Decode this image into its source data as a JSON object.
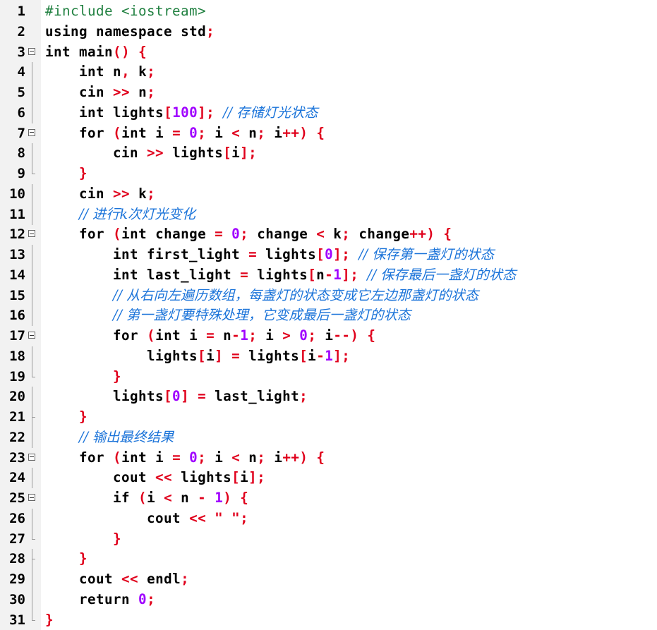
{
  "editor": {
    "language": "C++",
    "colors": {
      "background": "#ffffff",
      "gutter": "#f2f2f2",
      "operator": "#e0001c",
      "number": "#a000ff",
      "comment": "#1a73d9",
      "preprocessor": "#208040"
    },
    "lines": [
      {
        "n": "1",
        "text": "#include <iostream>"
      },
      {
        "n": "2",
        "text": "using namespace std;"
      },
      {
        "n": "3",
        "text": "int main() {"
      },
      {
        "n": "4",
        "text": "    int n, k;"
      },
      {
        "n": "5",
        "text": "    cin >> n;"
      },
      {
        "n": "6",
        "text": "    int lights[100]; // 存储灯光状态"
      },
      {
        "n": "7",
        "text": "    for (int i = 0; i < n; i++) {"
      },
      {
        "n": "8",
        "text": "        cin >> lights[i];"
      },
      {
        "n": "9",
        "text": "    }"
      },
      {
        "n": "10",
        "text": "    cin >> k;"
      },
      {
        "n": "11",
        "text": "    // 进行k次灯光变化"
      },
      {
        "n": "12",
        "text": "    for (int change = 0; change < k; change++) {"
      },
      {
        "n": "13",
        "text": "        int first_light = lights[0]; // 保存第一盏灯的状态"
      },
      {
        "n": "14",
        "text": "        int last_light = lights[n-1]; // 保存最后一盏灯的状态"
      },
      {
        "n": "15",
        "text": "        // 从右向左遍历数组，每盏灯的状态变成它左边那盏灯的状态"
      },
      {
        "n": "16",
        "text": "        // 第一盏灯要特殊处理，它变成最后一盏灯的状态"
      },
      {
        "n": "17",
        "text": "        for (int i = n-1; i > 0; i--) {"
      },
      {
        "n": "18",
        "text": "            lights[i] = lights[i-1];"
      },
      {
        "n": "19",
        "text": "        }"
      },
      {
        "n": "20",
        "text": "        lights[0] = last_light;"
      },
      {
        "n": "21",
        "text": "    }"
      },
      {
        "n": "22",
        "text": "    // 输出最终结果"
      },
      {
        "n": "23",
        "text": "    for (int i = 0; i < n; i++) {"
      },
      {
        "n": "24",
        "text": "        cout << lights[i];"
      },
      {
        "n": "25",
        "text": "        if (i < n - 1) {"
      },
      {
        "n": "26",
        "text": "            cout << \" \";"
      },
      {
        "n": "27",
        "text": "        }"
      },
      {
        "n": "28",
        "text": "    }"
      },
      {
        "n": "29",
        "text": "    cout << endl;"
      },
      {
        "n": "30",
        "text": "    return 0;"
      },
      {
        "n": "31",
        "text": "}"
      }
    ]
  }
}
